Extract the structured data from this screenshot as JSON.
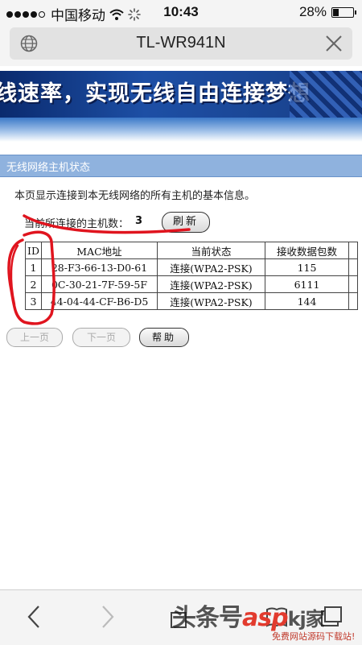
{
  "status_bar": {
    "carrier": "中国移动",
    "time": "10:43",
    "battery": "28%",
    "battery_level": 0.28
  },
  "browser": {
    "title": "TL-WR941N"
  },
  "banner": {
    "text": "线速率，实现无线自由连接梦想"
  },
  "panel": {
    "title": "无线网络主机状态",
    "description": "本页显示连接到本无线网络的所有主机的基本信息。",
    "host_count_label": "当前所连接的主机数：",
    "host_count": "3",
    "refresh_label": "刷新"
  },
  "table": {
    "headers": [
      "ID",
      "MAC地址",
      "当前状态",
      "接收数据包数",
      ""
    ],
    "rows": [
      {
        "id": "1",
        "mac": "28-F3-66-13-D0-61",
        "status": "连接(WPA2-PSK)",
        "packets": "115"
      },
      {
        "id": "2",
        "mac": "0C-30-21-7F-59-5F",
        "status": "连接(WPA2-PSK)",
        "packets": "6111"
      },
      {
        "id": "3",
        "mac": "44-04-44-CF-B6-D5",
        "status": "连接(WPA2-PSK)",
        "packets": "144"
      }
    ]
  },
  "pager": {
    "prev_label": "上一页",
    "next_label": "下一页",
    "help_label": "帮助"
  },
  "toolbar": {
    "icons": [
      "back-icon",
      "forward-icon",
      "share-icon",
      "bookmarks-icon",
      "tabs-icon"
    ]
  },
  "watermark": {
    "prefix": "头条号",
    "brand": "asp",
    "suffix": "kj家",
    "sub": "免费网站源码下载站!"
  },
  "colors": {
    "banner": "#1d4fa5",
    "panel_title": "#8fb2de",
    "annotation": "#e0141e",
    "watermark": "#e23b2e"
  }
}
